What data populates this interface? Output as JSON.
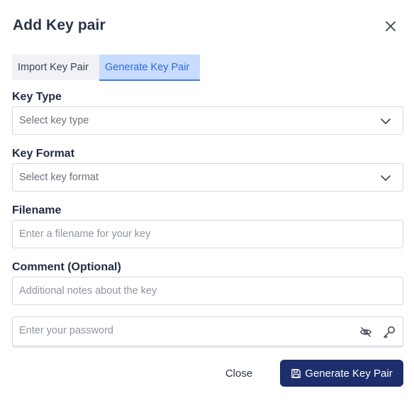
{
  "dialog": {
    "title": "Add Key pair"
  },
  "tabs": [
    {
      "label": "Import Key Pair",
      "active": false
    },
    {
      "label": "Generate Key Pair",
      "active": true
    }
  ],
  "form": {
    "key_type": {
      "label": "Key Type",
      "placeholder": "Select key type"
    },
    "key_format": {
      "label": "Key Format",
      "placeholder": "Select key format"
    },
    "filename": {
      "label": "Filename",
      "placeholder": "Enter a filename for your key"
    },
    "comment": {
      "label": "Comment (Optional)",
      "placeholder": "Additional notes about the key"
    },
    "password": {
      "placeholder": "Enter your password"
    }
  },
  "footer": {
    "close_label": "Close",
    "generate_label": "Generate Key Pair"
  },
  "icons": {
    "close": "close-icon",
    "chevron": "chevron-down-icon",
    "eye": "eye-off-icon",
    "key": "key-icon",
    "save": "save-icon"
  },
  "colors": {
    "primary_button": "#1c2e6b",
    "active_tab_bg": "#c8dcff",
    "active_tab_text": "#2d6ad6"
  }
}
